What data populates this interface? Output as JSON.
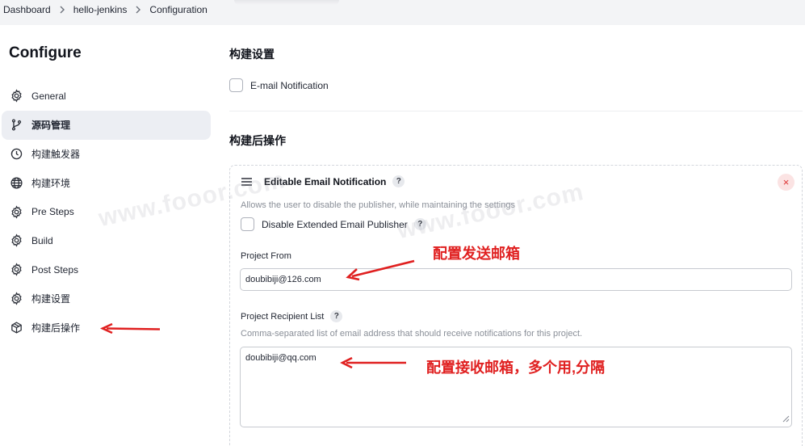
{
  "breadcrumb": [
    "Dashboard",
    "hello-jenkins",
    "Configuration"
  ],
  "sidebar": {
    "title": "Configure",
    "items": [
      {
        "label": "General",
        "icon": "gear-icon"
      },
      {
        "label": "源码管理",
        "icon": "branch-icon"
      },
      {
        "label": "构建触发器",
        "icon": "timer-icon"
      },
      {
        "label": "构建环境",
        "icon": "globe-icon"
      },
      {
        "label": "Pre Steps",
        "icon": "gear-icon"
      },
      {
        "label": "Build",
        "icon": "gear-icon"
      },
      {
        "label": "Post Steps",
        "icon": "gear-icon"
      },
      {
        "label": "构建设置",
        "icon": "gear-icon"
      },
      {
        "label": "构建后操作",
        "icon": "package-icon"
      }
    ],
    "active_index": 1
  },
  "main": {
    "build_settings": {
      "title": "构建设置",
      "email_notification_label": "E-mail Notification"
    },
    "post_build": {
      "title": "构建后操作",
      "card": {
        "title": "Editable Email Notification",
        "help_glyph": "?",
        "close_glyph": "×",
        "description": "Allows the user to disable the publisher, while maintaining the settings",
        "disable_label": "Disable Extended Email Publisher",
        "project_from": {
          "label": "Project From",
          "value": "doubibiji@126.com"
        },
        "recipient_list": {
          "label": "Project Recipient List",
          "description": "Comma-separated list of email address that should receive notifications for this project.",
          "value": "doubibiji@qq.com"
        }
      }
    }
  },
  "annotations": {
    "from_note": "配置发送邮箱",
    "recipient_note": "配置接收邮箱，多个用,分隔",
    "color": "#e02020"
  },
  "watermark": "www.fooor.com"
}
